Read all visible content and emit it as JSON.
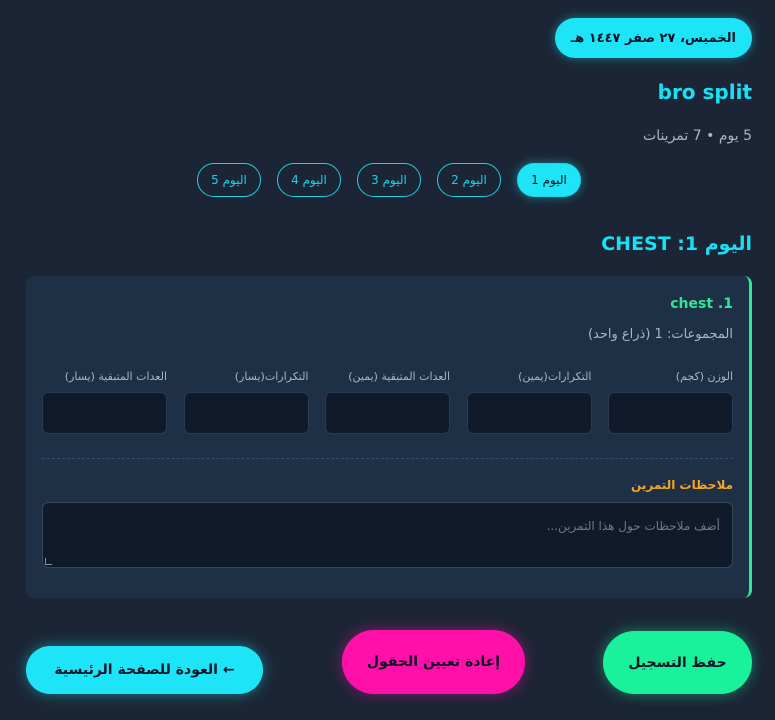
{
  "header": {
    "date": "الخميس، ٢٧ صفر ١٤٤٧ هـ",
    "plan_title": "bro split",
    "plan_meta": "5 يوم • 7 تمرينات"
  },
  "day_tabs": [
    {
      "label": "اليوم 1",
      "active": true
    },
    {
      "label": "اليوم 2",
      "active": false
    },
    {
      "label": "اليوم 3",
      "active": false
    },
    {
      "label": "اليوم 4",
      "active": false
    },
    {
      "label": "اليوم 5",
      "active": false
    }
  ],
  "day_heading": "اليوم 1: CHEST",
  "exercise": {
    "name": "1. chest",
    "sets": "المجموعات: 1 (ذراع واحد)",
    "fields": [
      {
        "label": "الوزن (كجم)",
        "value": ""
      },
      {
        "label": "التكرارات(يمين)",
        "value": ""
      },
      {
        "label": "العدات المتبقية (يمين)",
        "value": ""
      },
      {
        "label": "التكرارات(يسار)",
        "value": ""
      },
      {
        "label": "العدات المتبقية (يسار)",
        "value": ""
      }
    ],
    "notes_label": "ملاحظات التمرين",
    "notes_placeholder": "أضف ملاحظات حول هذا التمرين...",
    "notes_value": ""
  },
  "actions": {
    "save": "حفظ التسجيل",
    "reset": "إعادة تعيين الحقول",
    "home": "← العودة للصفحة الرئيسية"
  },
  "colors": {
    "background": "#1b2535",
    "accent_cyan": "#1ee4f7",
    "accent_green": "#19f29a",
    "accent_pink": "#ff10a8",
    "accent_orange": "#f5a524"
  }
}
